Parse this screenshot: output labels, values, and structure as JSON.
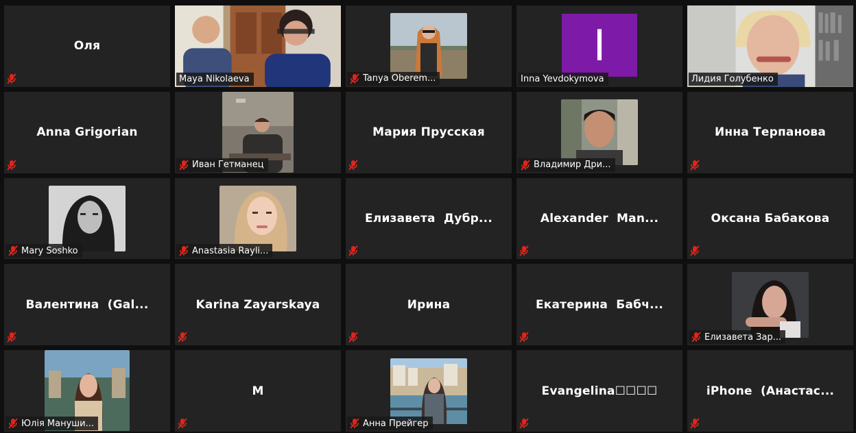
{
  "participants": [
    {
      "name": "Оля",
      "display": "name",
      "muted": true
    },
    {
      "name": "Maya Nikolaeva",
      "display": "video",
      "muted": false,
      "video": "couple"
    },
    {
      "name": "Tanya Oberem...",
      "display": "video",
      "muted": true,
      "video": "woman-outdoor"
    },
    {
      "name": "Inna Yevdokymova",
      "display": "avatar",
      "muted": false,
      "avatar_letter": "I",
      "avatar_color": "#7d1aa8"
    },
    {
      "name": "Лидия Голубенко",
      "display": "video",
      "muted": false,
      "active_speaker": true,
      "video": "woman-books"
    },
    {
      "name": "Anna Grigorian",
      "display": "name",
      "muted": true
    },
    {
      "name": "Иван Гетманец",
      "display": "video",
      "muted": true,
      "video": "man-room"
    },
    {
      "name": "Мария Прусская",
      "display": "name",
      "muted": true
    },
    {
      "name": "Владимир Дри...",
      "display": "video",
      "muted": true,
      "video": "man-portrait"
    },
    {
      "name": "Инна Терпанова",
      "display": "name",
      "muted": true
    },
    {
      "name": "Mary Soshko",
      "display": "video",
      "muted": true,
      "video": "woman-bw"
    },
    {
      "name": "Anastasia Rayli...",
      "display": "video",
      "muted": true,
      "video": "woman-blonde"
    },
    {
      "name": "Елизавета  Дубр...",
      "display": "name",
      "muted": true
    },
    {
      "name": "Alexander  Man...",
      "display": "name",
      "muted": true
    },
    {
      "name": "Оксана Бабакова",
      "display": "name",
      "muted": true
    },
    {
      "name": "Валентина  (Gal...",
      "display": "name",
      "muted": true
    },
    {
      "name": "Karina Zayarskaya",
      "display": "name",
      "muted": true
    },
    {
      "name": "Ирина",
      "display": "name",
      "muted": true
    },
    {
      "name": "Екатерина  Бабч...",
      "display": "name",
      "muted": true
    },
    {
      "name": "Елизавета Зар...",
      "display": "video",
      "muted": true,
      "video": "woman-dark"
    },
    {
      "name": "Юлія Мануши...",
      "display": "video",
      "muted": true,
      "video": "woman-city"
    },
    {
      "name": "M",
      "display": "name",
      "muted": true
    },
    {
      "name": "Анна Прейгер",
      "display": "video",
      "muted": true,
      "video": "woman-canal"
    },
    {
      "name": "Evangelina☐☐☐☐",
      "display": "name",
      "muted": true
    },
    {
      "name": "iPhone  (Анастас...",
      "display": "name",
      "muted": true
    }
  ],
  "colors": {
    "tile_bg": "#232323",
    "active_speaker_border": "#c9d93b",
    "muted_icon": "#e0241b"
  },
  "icons": {
    "muted": "mic-off-icon"
  }
}
